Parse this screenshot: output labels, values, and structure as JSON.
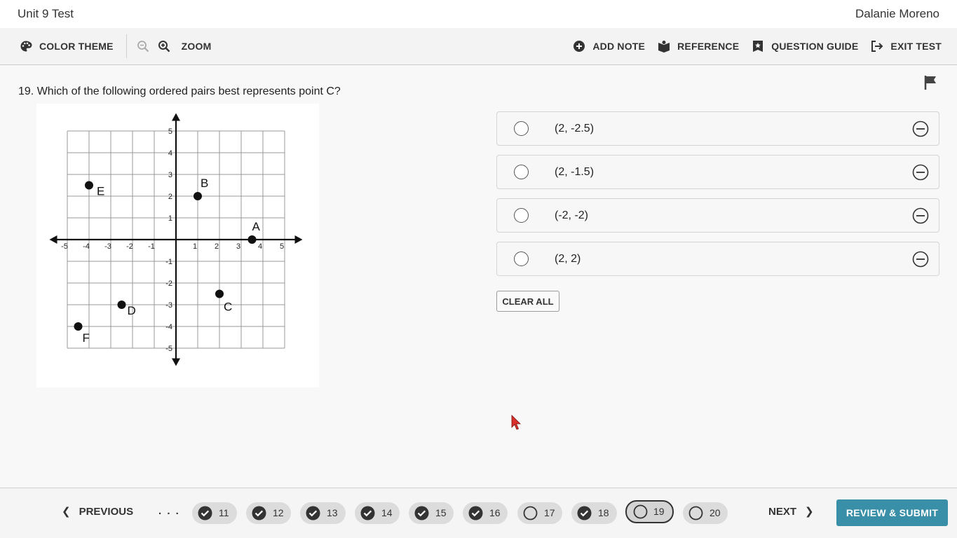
{
  "header": {
    "test_title": "Unit 9 Test",
    "student_name": "Dalanie Moreno"
  },
  "toolbar": {
    "color_theme_label": "COLOR THEME",
    "zoom_label": "ZOOM",
    "add_note_label": "ADD NOTE",
    "reference_label": "REFERENCE",
    "question_guide_label": "QUESTION GUIDE",
    "exit_test_label": "EXIT TEST"
  },
  "question": {
    "number": "19.",
    "text": "Which of the following ordered pairs best represents point C?"
  },
  "graph": {
    "x_ticks": [
      "-5",
      "-4",
      "-3",
      "-2",
      "-1",
      "1",
      "2",
      "3",
      "4",
      "5"
    ],
    "y_ticks": [
      "5",
      "4",
      "3",
      "2",
      "1",
      "-1",
      "-2",
      "-3",
      "-4",
      "-5"
    ],
    "points": [
      {
        "label": "A",
        "x": 3.5,
        "y": 0
      },
      {
        "label": "B",
        "x": 1,
        "y": 2
      },
      {
        "label": "C",
        "x": 2,
        "y": -2.5
      },
      {
        "label": "D",
        "x": -2.5,
        "y": -3
      },
      {
        "label": "E",
        "x": -4,
        "y": 2.5
      },
      {
        "label": "F",
        "x": -4.5,
        "y": -4
      }
    ]
  },
  "options": [
    {
      "label": "(2, -2.5)"
    },
    {
      "label": "(2, -1.5)"
    },
    {
      "label": "(-2, -2)"
    },
    {
      "label": "(2, 2)"
    }
  ],
  "clear_all_label": "CLEAR ALL",
  "navigation": {
    "previous_label": "PREVIOUS",
    "next_label": "NEXT",
    "ellipsis": ". . .",
    "submit_label": "REVIEW & SUBMIT",
    "questions": [
      {
        "num": "11",
        "state": "answered"
      },
      {
        "num": "12",
        "state": "answered"
      },
      {
        "num": "13",
        "state": "answered"
      },
      {
        "num": "14",
        "state": "answered"
      },
      {
        "num": "15",
        "state": "answered"
      },
      {
        "num": "16",
        "state": "answered"
      },
      {
        "num": "17",
        "state": "unanswered"
      },
      {
        "num": "18",
        "state": "answered"
      },
      {
        "num": "19",
        "state": "current"
      },
      {
        "num": "20",
        "state": "unanswered"
      }
    ]
  },
  "colors": {
    "submit_bg": "#3a8fa8",
    "pill_bg": "#dcdcdc",
    "cursor": "#d9302b"
  }
}
